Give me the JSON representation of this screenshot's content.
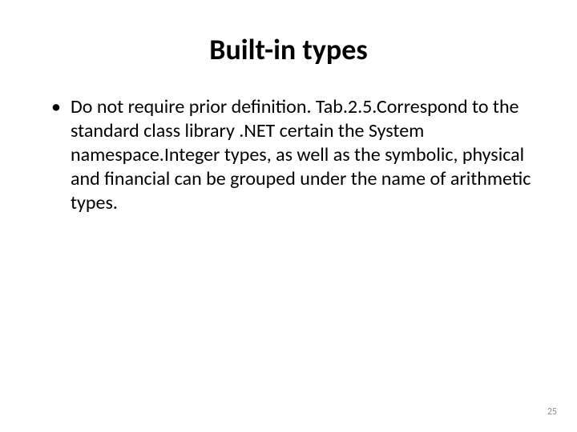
{
  "title": "Built-in types",
  "bullets": [
    "Do not require prior definition. Tab.2.5.Correspond to the standard class library .NET certain the System namespace.Integer types, as well as the symbolic, physical and financial can be grouped under the name of arithmetic types."
  ],
  "page_number": "25"
}
